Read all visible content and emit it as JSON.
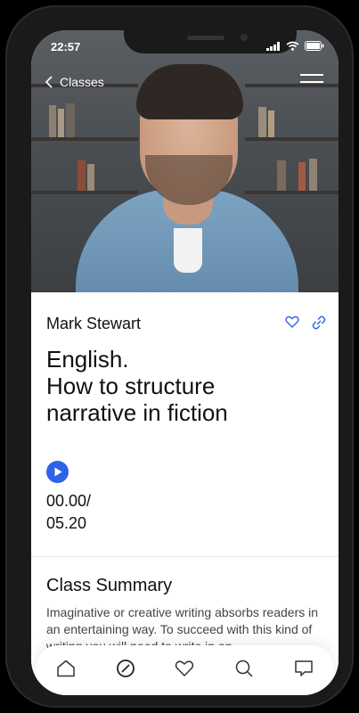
{
  "status_bar": {
    "time": "22:57"
  },
  "nav": {
    "back_label": "Classes"
  },
  "class": {
    "instructor": "Mark Stewart",
    "title_line1": "English.",
    "title_line2": "How to structure",
    "title_line3": "narrative in fiction",
    "time_current": "00.00/",
    "time_total": "05.20"
  },
  "summary": {
    "heading": "Class Summary",
    "text": "Imaginative or creative writing absorbs readers in an entertaining way. To succeed with this kind of writing you will need to write in an"
  },
  "tab_bar": {
    "items": [
      {
        "icon": "home-icon"
      },
      {
        "icon": "compass-icon"
      },
      {
        "icon": "heart-icon"
      },
      {
        "icon": "search-icon"
      },
      {
        "icon": "chat-icon"
      }
    ]
  },
  "colors": {
    "accent": "#2d63e8",
    "text": "#111111"
  }
}
